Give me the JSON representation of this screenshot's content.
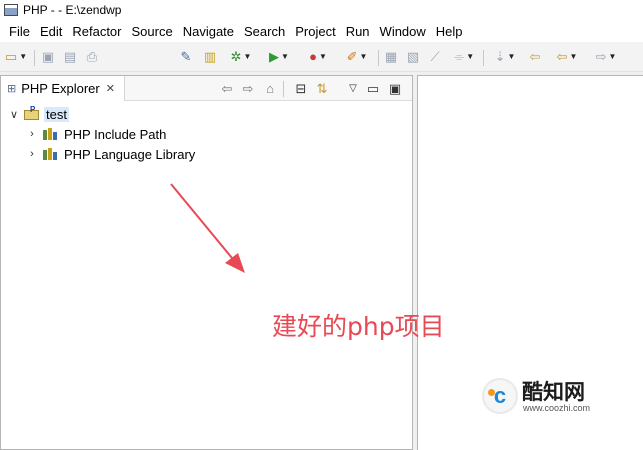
{
  "window": {
    "title": "PHP -  - E:\\zendwp"
  },
  "menu": [
    "File",
    "Edit",
    "Refactor",
    "Source",
    "Navigate",
    "Search",
    "Project",
    "Run",
    "Window",
    "Help"
  ],
  "toolbar": {
    "buttons": [
      {
        "icon": "new-icon",
        "glyph": "▭",
        "color": "#d98b1e"
      },
      {
        "icon": "save-icon",
        "glyph": "▣",
        "color": "#9aa4b3"
      },
      {
        "icon": "save-all-icon",
        "glyph": "▤",
        "color": "#9aa4b3"
      },
      {
        "icon": "print-icon",
        "glyph": "⎙",
        "color": "#9aa4b3"
      },
      {
        "icon": "php-debug-icon",
        "glyph": "✎",
        "color": "#3a6ea5"
      },
      {
        "icon": "php-library-icon",
        "glyph": "▥",
        "color": "#c8a11a"
      },
      {
        "icon": "debug-icon",
        "glyph": "✲",
        "color": "#2f8c2f"
      },
      {
        "icon": "run-icon",
        "glyph": "▶",
        "color": "#2a9d2a"
      },
      {
        "icon": "run-external-icon",
        "glyph": "●",
        "color": "#c23b3b"
      },
      {
        "icon": "tools-icon",
        "glyph": "✐",
        "color": "#c07a2a"
      },
      {
        "icon": "open-type-icon",
        "glyph": "▦",
        "color": "#9aa4b3"
      },
      {
        "icon": "open-resource-icon",
        "glyph": "▧",
        "color": "#9aa4b3"
      },
      {
        "icon": "edit-icon",
        "glyph": "⟋",
        "color": "#9aa4b3"
      },
      {
        "icon": "annotation-icon",
        "glyph": "⌯",
        "color": "#9aa4b3"
      },
      {
        "icon": "next-annotation-icon",
        "glyph": "⇣",
        "color": "#9aa4b3"
      },
      {
        "icon": "last-edit-icon",
        "glyph": "⇦",
        "color": "#c0a14a"
      },
      {
        "icon": "back-icon",
        "glyph": "⇦",
        "color": "#c59a2a"
      },
      {
        "icon": "forward-icon",
        "glyph": "⇨",
        "color": "#9aa4b3"
      }
    ]
  },
  "explorer": {
    "tab_title": "PHP Explorer",
    "tab_close": "✕",
    "tree": {
      "project": "test",
      "children": [
        "PHP Include Path",
        "PHP Language Library"
      ]
    }
  },
  "annotation": {
    "text": "建好的php项目",
    "color": "#e84a55"
  },
  "watermark": {
    "name": "酷知网",
    "url": "www.coozhi.com",
    "logo_letter": "c"
  }
}
